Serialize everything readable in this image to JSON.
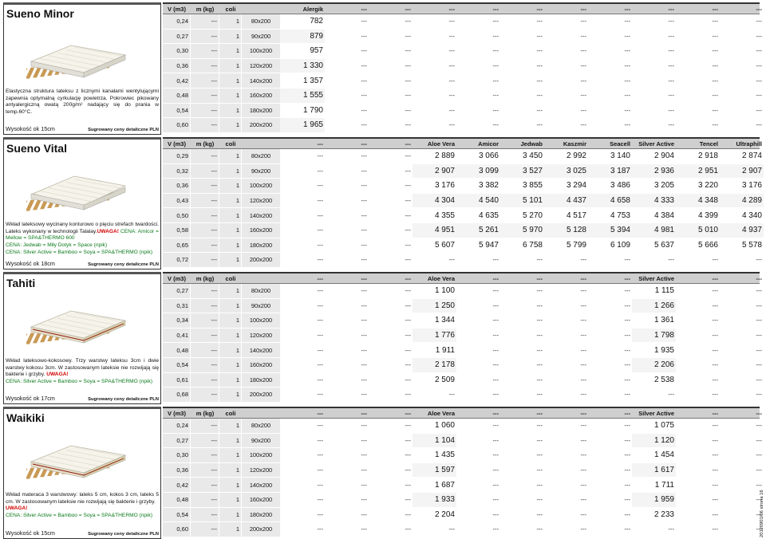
{
  "price_note": "Sugrowany ceny detaliczne PLN",
  "side_note": "20120901/06 strona 16",
  "products": [
    {
      "name": "Sueno Minor",
      "description_parts": [
        {
          "text": "Elastyczna struktura lateksu z licznymi kanałami wentylującymi zapewnia optymalną cyrkulację powietrza. Pokrowiec pikowany antyalergiczną owatą 200g/m² nadający się do prania w temp.60°C.",
          "style": "normal"
        }
      ],
      "height": "Wysokość ok 15cm",
      "columns": [
        "V (m3)",
        "m (kg)",
        "coli",
        "",
        "Alergik",
        "---",
        "---",
        "---",
        "---",
        "---",
        "---",
        "---",
        "---",
        "---",
        "---"
      ],
      "rows": [
        [
          "0,24",
          "---",
          "1",
          "80x200",
          "782",
          "---",
          "---",
          "---",
          "---",
          "---",
          "---",
          "---",
          "---",
          "---",
          "---"
        ],
        [
          "0,27",
          "---",
          "1",
          "90x200",
          "879",
          "---",
          "---",
          "---",
          "---",
          "---",
          "---",
          "---",
          "---",
          "---",
          "---"
        ],
        [
          "0,30",
          "---",
          "1",
          "100x200",
          "957",
          "---",
          "---",
          "---",
          "---",
          "---",
          "---",
          "---",
          "---",
          "---",
          "---"
        ],
        [
          "0,36",
          "---",
          "1",
          "120x200",
          "1 330",
          "---",
          "---",
          "---",
          "---",
          "---",
          "---",
          "---",
          "---",
          "---",
          "---"
        ],
        [
          "0,42",
          "---",
          "1",
          "140x200",
          "1 357",
          "---",
          "---",
          "---",
          "---",
          "---",
          "---",
          "---",
          "---",
          "---",
          "---"
        ],
        [
          "0,48",
          "---",
          "1",
          "160x200",
          "1 555",
          "---",
          "---",
          "---",
          "---",
          "---",
          "---",
          "---",
          "---",
          "---",
          "---"
        ],
        [
          "0,54",
          "---",
          "1",
          "180x200",
          "1 790",
          "---",
          "---",
          "---",
          "---",
          "---",
          "---",
          "---",
          "---",
          "---",
          "---"
        ],
        [
          "0,60",
          "---",
          "1",
          "200x200",
          "1 965",
          "---",
          "---",
          "---",
          "---",
          "---",
          "---",
          "---",
          "---",
          "---",
          "---"
        ]
      ]
    },
    {
      "name": "Sueno Vital",
      "description_parts": [
        {
          "text": "Wkład lateksowy wycinany konturowo o pięciu strefach twardości. Lateks wykonany w technologii Talalay.",
          "style": "normal"
        },
        {
          "text": "UWAGA!",
          "style": "warn"
        },
        {
          "text": " CENA: Amicor = Mellow = SPA&THERMO 600",
          "style": "green"
        },
        {
          "text": "CENA: Jedwab = Miły Dotyk = Space (npik)",
          "style": "green-line"
        },
        {
          "text": "CENA: Silver Active = Bamboo = Soya = SPA&THERMO (npik)",
          "style": "green-line"
        }
      ],
      "height": "Wysokość ok 18cm",
      "columns": [
        "V (m3)",
        "m (kg)",
        "coli",
        "",
        "---",
        "---",
        "---",
        "Aloe Vera",
        "Amicor",
        "Jedwab",
        "Kaszmir",
        "Seacell",
        "Silver Active",
        "Tencel",
        "Ultraphill"
      ],
      "rows": [
        [
          "0,29",
          "---",
          "1",
          "80x200",
          "---",
          "---",
          "---",
          "2 889",
          "3 066",
          "3 450",
          "2 992",
          "3 140",
          "2 904",
          "2 918",
          "2 874"
        ],
        [
          "0,32",
          "---",
          "1",
          "90x200",
          "---",
          "---",
          "---",
          "2 907",
          "3 099",
          "3 527",
          "3 025",
          "3 187",
          "2 936",
          "2 951",
          "2 907"
        ],
        [
          "0,36",
          "---",
          "1",
          "100x200",
          "---",
          "---",
          "---",
          "3 176",
          "3 382",
          "3 855",
          "3 294",
          "3 486",
          "3 205",
          "3 220",
          "3 176"
        ],
        [
          "0,43",
          "---",
          "1",
          "120x200",
          "---",
          "---",
          "---",
          "4 304",
          "4 540",
          "5 101",
          "4 437",
          "4 658",
          "4 333",
          "4 348",
          "4 289"
        ],
        [
          "0,50",
          "---",
          "1",
          "140x200",
          "---",
          "---",
          "---",
          "4 355",
          "4 635",
          "5 270",
          "4 517",
          "4 753",
          "4 384",
          "4 399",
          "4 340"
        ],
        [
          "0,58",
          "---",
          "1",
          "160x200",
          "---",
          "---",
          "---",
          "4 951",
          "5 261",
          "5 970",
          "5 128",
          "5 394",
          "4 981",
          "5 010",
          "4 937"
        ],
        [
          "0,65",
          "---",
          "1",
          "180x200",
          "---",
          "---",
          "---",
          "5 607",
          "5 947",
          "6 758",
          "5 799",
          "6 109",
          "5 637",
          "5 666",
          "5 578"
        ],
        [
          "0,72",
          "---",
          "1",
          "200x200",
          "---",
          "---",
          "---",
          "---",
          "---",
          "---",
          "---",
          "---",
          "---",
          "---",
          "---"
        ]
      ]
    },
    {
      "name": "Tahiti",
      "description_parts": [
        {
          "text": "Wkład lateksowo-kokosowy. Trzy warstwy lateksu 3cm i dwie warstwy kokosu 3cm. W zastosowanym lateksie nie rozwijają się bakterie i grzyby. ",
          "style": "normal"
        },
        {
          "text": "UWAGA!",
          "style": "warn"
        },
        {
          "text": "CENA: Silver Active = Bamboo = Soya = SPA&THERMO (npik)",
          "style": "green-line"
        }
      ],
      "height": "Wysokość ok 17cm",
      "columns": [
        "V (m3)",
        "m (kg)",
        "coli",
        "",
        "---",
        "---",
        "---",
        "Aloe Vera",
        "---",
        "---",
        "---",
        "---",
        "Silver Active",
        "---",
        "---"
      ],
      "rows": [
        [
          "0,27",
          "---",
          "1",
          "80x200",
          "---",
          "---",
          "---",
          "1 100",
          "---",
          "---",
          "---",
          "---",
          "1 115",
          "---",
          "---"
        ],
        [
          "0,31",
          "---",
          "1",
          "90x200",
          "---",
          "---",
          "---",
          "1 250",
          "---",
          "---",
          "---",
          "---",
          "1 266",
          "---",
          "---"
        ],
        [
          "0,34",
          "---",
          "1",
          "100x200",
          "---",
          "---",
          "---",
          "1 344",
          "---",
          "---",
          "---",
          "---",
          "1 361",
          "---",
          "---"
        ],
        [
          "0,41",
          "---",
          "1",
          "120x200",
          "---",
          "---",
          "---",
          "1 776",
          "---",
          "---",
          "---",
          "---",
          "1 798",
          "---",
          "---"
        ],
        [
          "0,48",
          "---",
          "1",
          "140x200",
          "---",
          "---",
          "---",
          "1 911",
          "---",
          "---",
          "---",
          "---",
          "1 935",
          "---",
          "---"
        ],
        [
          "0,54",
          "---",
          "1",
          "160x200",
          "---",
          "---",
          "---",
          "2 178",
          "---",
          "---",
          "---",
          "---",
          "2 206",
          "---",
          "---"
        ],
        [
          "0,61",
          "---",
          "1",
          "180x200",
          "---",
          "---",
          "---",
          "2 509",
          "---",
          "---",
          "---",
          "---",
          "2 538",
          "---",
          "---"
        ],
        [
          "0,68",
          "---",
          "1",
          "200x200",
          "---",
          "---",
          "---",
          "---",
          "---",
          "---",
          "---",
          "---",
          "---",
          "---",
          "---"
        ]
      ]
    },
    {
      "name": "Waikiki",
      "description_parts": [
        {
          "text": "Wkład materaca 3 warstwowy: lateks 5 cm, kokos 3 cm, lateks 5 cm. W zastosowanym lateksie nie rozwijają się bakterie i grzyby.",
          "style": "normal"
        },
        {
          "text": "UWAGA!",
          "style": "warn-line"
        },
        {
          "text": "CENA: Silver Active = Bamboo = Soya = SPA&THERMO (npik)",
          "style": "green-line"
        }
      ],
      "height": "Wysokość ok 15cm",
      "columns": [
        "V (m3)",
        "m (kg)",
        "coli",
        "",
        "---",
        "---",
        "---",
        "Aloe Vera",
        "---",
        "---",
        "---",
        "---",
        "Silver Active",
        "---",
        "---"
      ],
      "rows": [
        [
          "0,24",
          "---",
          "1",
          "80x200",
          "---",
          "---",
          "---",
          "1 060",
          "---",
          "---",
          "---",
          "---",
          "1 075",
          "---",
          "---"
        ],
        [
          "0,27",
          "---",
          "1",
          "90x200",
          "---",
          "---",
          "---",
          "1 104",
          "---",
          "---",
          "---",
          "---",
          "1 120",
          "---",
          "---"
        ],
        [
          "0,30",
          "---",
          "1",
          "100x200",
          "---",
          "---",
          "---",
          "1 435",
          "---",
          "---",
          "---",
          "---",
          "1 454",
          "---",
          "---"
        ],
        [
          "0,36",
          "---",
          "1",
          "120x200",
          "---",
          "---",
          "---",
          "1 597",
          "---",
          "---",
          "---",
          "---",
          "1 617",
          "---",
          "---"
        ],
        [
          "0,42",
          "---",
          "1",
          "140x200",
          "---",
          "---",
          "---",
          "1 687",
          "---",
          "---",
          "---",
          "---",
          "1 711",
          "---",
          "---"
        ],
        [
          "0,48",
          "---",
          "1",
          "160x200",
          "---",
          "---",
          "---",
          "1 933",
          "---",
          "---",
          "---",
          "---",
          "1 959",
          "---",
          "---"
        ],
        [
          "0,54",
          "---",
          "1",
          "180x200",
          "---",
          "---",
          "---",
          "2 204",
          "---",
          "---",
          "---",
          "---",
          "2 233",
          "---",
          "---"
        ],
        [
          "0,60",
          "---",
          "1",
          "200x200",
          "---",
          "---",
          "---",
          "---",
          "---",
          "---",
          "---",
          "---",
          "---",
          "---",
          "---"
        ]
      ]
    }
  ]
}
